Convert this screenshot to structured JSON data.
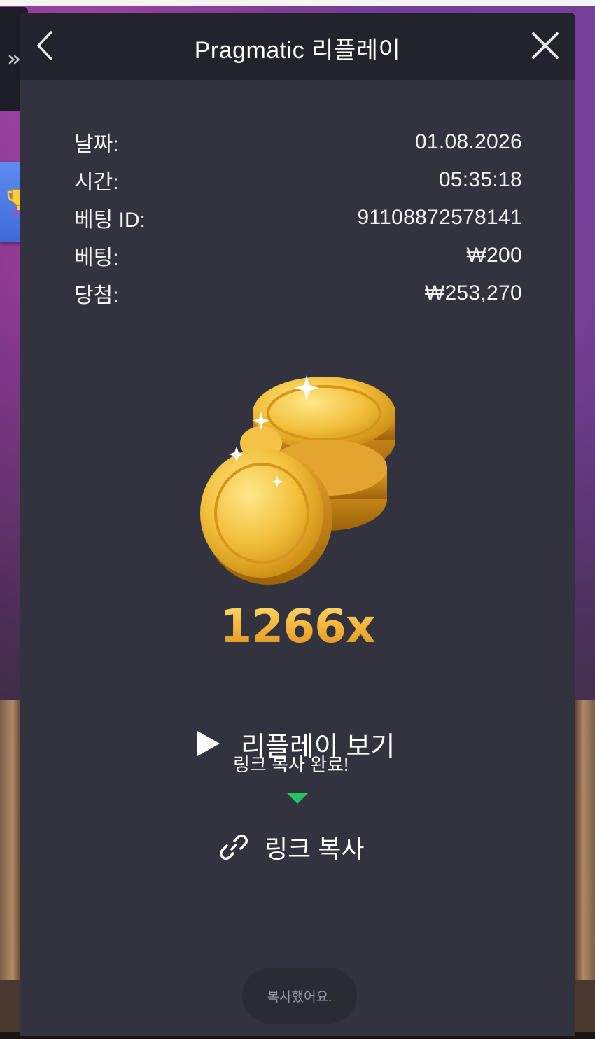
{
  "modal": {
    "title": "Pragmatic 리플레이"
  },
  "details": [
    {
      "label": "날짜:",
      "value": "01.08.2026"
    },
    {
      "label": "시간:",
      "value": "05:35:18"
    },
    {
      "label": "베팅 ID:",
      "value": "91108872578141"
    },
    {
      "label": "베팅:",
      "value": "₩200"
    },
    {
      "label": "당첨:",
      "value": "₩253,270"
    }
  ],
  "result": {
    "multiplier": "1266x"
  },
  "actions": {
    "replay_label": "리플레이 보기",
    "copy_link_label": "링크 복사",
    "copied_tooltip": "링크 복사 완료!"
  },
  "toast": {
    "message": "복사했어요."
  },
  "icons": {
    "back": "chevron-left-icon",
    "close": "close-icon",
    "expand": "double-chevron-right-icon",
    "trophy": "trophy-icon",
    "coins": "gold-coins-icon",
    "play": "play-icon",
    "link": "link-icon"
  },
  "colors": {
    "modal_bg": "#33333f",
    "header_bg": "#23232c",
    "gold": "#f4b53a",
    "tooltip_arrow": "#22c55e"
  }
}
